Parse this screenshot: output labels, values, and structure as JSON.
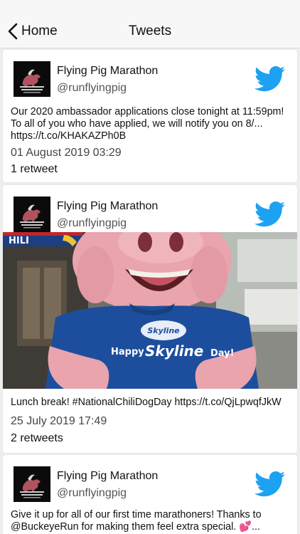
{
  "nav": {
    "back_label": "Home",
    "title": "Tweets"
  },
  "colors": {
    "twitter_blue": "#1da1f2",
    "shirt_blue": "#1d4e9d",
    "pig_pink": "#e9a4ad"
  },
  "tweets": [
    {
      "author": "Flying Pig Marathon",
      "handle": "@runflyingpig",
      "text": "Our 2020 ambassador applications close tonight at 11:59pm! To all of you who have applied, we will notify you on 8/... https://t.co/KHAKAZPh0B",
      "date": "01 August 2019 03:29",
      "retweets": "1 retweet",
      "icon": "twitter-bird-icon"
    },
    {
      "author": "Flying Pig Marathon",
      "handle": "@runflyingpig",
      "photo": {
        "shirt_line1": "Happy",
        "shirt_line2": "Skyline",
        "shirt_line3": "Day!",
        "logo_text": "Skyline",
        "sign_text": "HILI"
      },
      "text": "Lunch break! #NationalChiliDogDay https://t.co/QjLpwqfJkW",
      "date": "25 July 2019 17:49",
      "retweets": "2 retweets",
      "icon": "twitter-bird-icon"
    },
    {
      "author": "Flying Pig Marathon",
      "handle": "@runflyingpig",
      "text": "Give it up for all of our first time marathoners! Thanks to @BuckeyeRun for making them feel extra special. 💕...",
      "icon": "twitter-bird-icon"
    }
  ]
}
